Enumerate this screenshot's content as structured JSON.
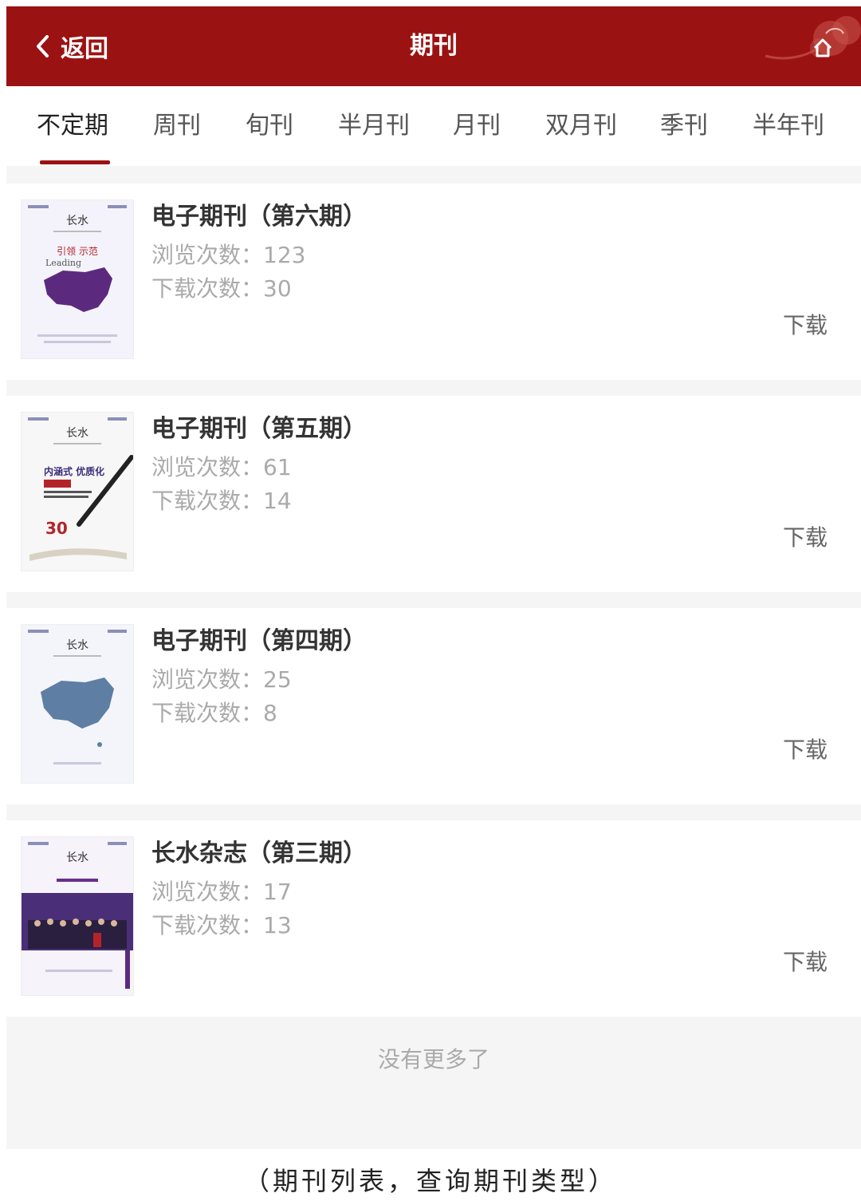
{
  "header": {
    "back_label": "返回",
    "title": "期刊",
    "color": "#9b1212"
  },
  "tabs": [
    {
      "label": "不定期",
      "active": true
    },
    {
      "label": "周刊",
      "active": false
    },
    {
      "label": "旬刊",
      "active": false
    },
    {
      "label": "半月刊",
      "active": false
    },
    {
      "label": "月刊",
      "active": false
    },
    {
      "label": "双月刊",
      "active": false
    },
    {
      "label": "季刊",
      "active": false
    },
    {
      "label": "半年刊",
      "active": false
    }
  ],
  "journals": [
    {
      "title": "电子期刊（第六期）",
      "views": "浏览次数：123",
      "downloads": "下载次数：30",
      "download_label": "下载",
      "cover": "cover-map-purple"
    },
    {
      "title": "电子期刊（第五期）",
      "views": "浏览次数：61",
      "downloads": "下载次数：14",
      "download_label": "下载",
      "cover": "cover-pen"
    },
    {
      "title": "电子期刊（第四期）",
      "views": "浏览次数：25",
      "downloads": "下载次数：8",
      "download_label": "下载",
      "cover": "cover-map-blue"
    },
    {
      "title": "长水杂志（第三期）",
      "views": "浏览次数：17",
      "downloads": "下载次数：13",
      "download_label": "下载",
      "cover": "cover-group-photo"
    }
  ],
  "footer": {
    "end_text": "没有更多了"
  },
  "caption": "（期刊列表，查询期刊类型）"
}
